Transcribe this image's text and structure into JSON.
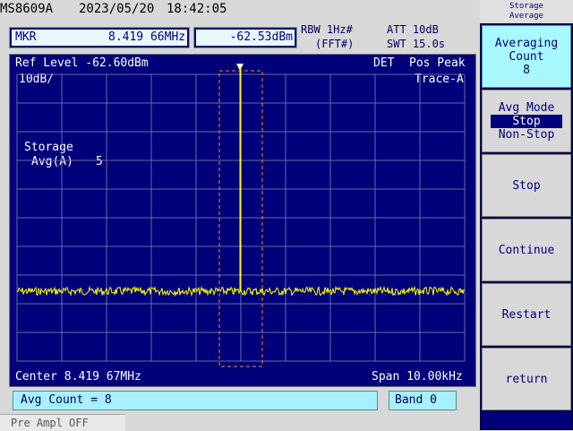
{
  "header": {
    "model": "MS8609A",
    "date": "2023/05/20",
    "time": "18:42:05",
    "marker_label": "MKR",
    "marker_freq": "8.419 66MHz",
    "marker_level": "-62.53dBm",
    "rbw": "RBW 1Hz#",
    "fft": "(FFT#)",
    "att": "ATT 10dB",
    "swt": "SWT 15.0s"
  },
  "screen": {
    "ref_level": "Ref Level -62.60dBm",
    "scale": "10dB/",
    "det": "DET",
    "det_mode": "Pos Peak",
    "trace": "Trace-A",
    "storage": "Storage",
    "avg_label": "Avg(A)",
    "avg_value": "5",
    "center": "Center 8.419 67MHz",
    "span": "Span 10.00kHz"
  },
  "bottom": {
    "avg_count": "Avg Count = 8",
    "band": "Band 0",
    "status": "Pre Ampl OFF"
  },
  "panel": {
    "title_line1": "Storage",
    "title_line2": "Average",
    "softkeys": [
      {
        "line1": "Averaging",
        "line2": "Count",
        "line3": "8"
      },
      {
        "title": "Avg Mode",
        "opt1": "Stop",
        "opt2": "Non-Stop"
      },
      {
        "label": "Stop"
      },
      {
        "label": "Continue"
      },
      {
        "label": "Restart"
      },
      {
        "label": "return"
      }
    ]
  },
  "colors": {
    "screen_bg": "#00007a",
    "grid": "#6a6aa8",
    "trace": "#ffff00",
    "marker_box": "#ff8800"
  }
}
